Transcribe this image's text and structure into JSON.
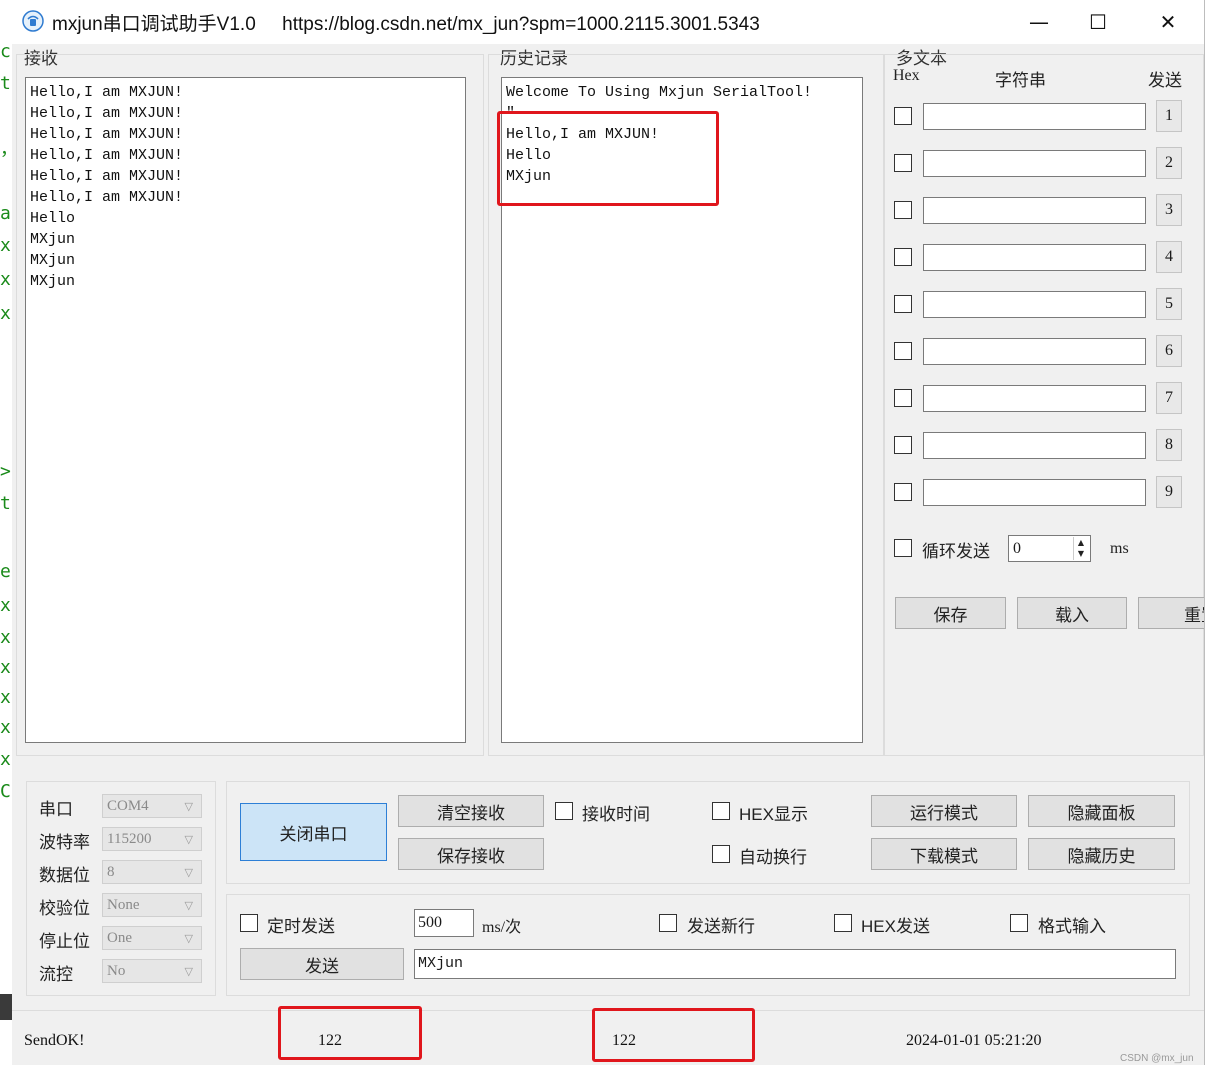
{
  "titlebar": {
    "title": "mxjun串口调试助手V1.0     https://blog.csdn.net/mx_jun?spm=1000.2115.3001.5343",
    "minimize": "—",
    "maximize": "☐",
    "close": "✕"
  },
  "receive": {
    "label": "接收",
    "lines": [
      "Hello,I am MXJUN!",
      "Hello,I am MXJUN!",
      "Hello,I am MXJUN!",
      "Hello,I am MXJUN!",
      "Hello,I am MXJUN!",
      "Hello,I am MXJUN!",
      "Hello",
      "MXjun",
      "MXjun",
      "MXjun"
    ]
  },
  "history": {
    "label": "历史记录",
    "lines": [
      "Welcome To Using Mxjun SerialTool!",
      "\"",
      "Hello,I am MXJUN!",
      "Hello",
      "MXjun"
    ]
  },
  "multitext": {
    "label": "多文本",
    "col_hex": "Hex",
    "col_string": "字符串",
    "col_send": "发送",
    "rows": [
      "1",
      "2",
      "3",
      "4",
      "5",
      "6",
      "7",
      "8",
      "9"
    ],
    "loop_label": "循环发送",
    "loop_value": "0",
    "loop_unit": "ms",
    "save": "保存",
    "load": "载入",
    "reset": "重置"
  },
  "serial": {
    "port_label": "串口",
    "port_value": "COM4",
    "baud_label": "波特率",
    "baud_value": "115200",
    "databits_label": "数据位",
    "databits_value": "8",
    "parity_label": "校验位",
    "parity_value": "None",
    "stopbits_label": "停止位",
    "stopbits_value": "One",
    "flow_label": "流控",
    "flow_value": "No"
  },
  "controls": {
    "close_port": "关闭串口",
    "clear_receive": "清空接收",
    "save_receive": "保存接收",
    "receive_time": "接收时间",
    "hex_display": "HEX显示",
    "auto_newline": "自动换行",
    "run_mode": "运行模式",
    "download_mode": "下载模式",
    "hide_panel": "隐藏面板",
    "hide_history": "隐藏历史"
  },
  "send": {
    "timed_send": "定时发送",
    "interval": "500",
    "interval_unit": "ms/次",
    "send_newline": "发送新行",
    "hex_send": "HEX发送",
    "format_input": "格式输入",
    "send_button": "发送",
    "send_text": "MXjun"
  },
  "statusbar": {
    "status": "SendOK!",
    "rx_count": "122",
    "tx_count": "122",
    "datetime": "2024-01-01 05:21:20",
    "watermark": "CSDN @mx_jun"
  },
  "background": {
    "chars": [
      "c",
      "t",
      "",
      "，",
      "",
      "a",
      "x",
      "x",
      "x",
      "",
      "",
      "",
      "",
      "",
      "",
      ">",
      "t",
      "",
      "e",
      "x",
      "x",
      "x",
      "x",
      "x",
      "x",
      "C"
    ]
  }
}
